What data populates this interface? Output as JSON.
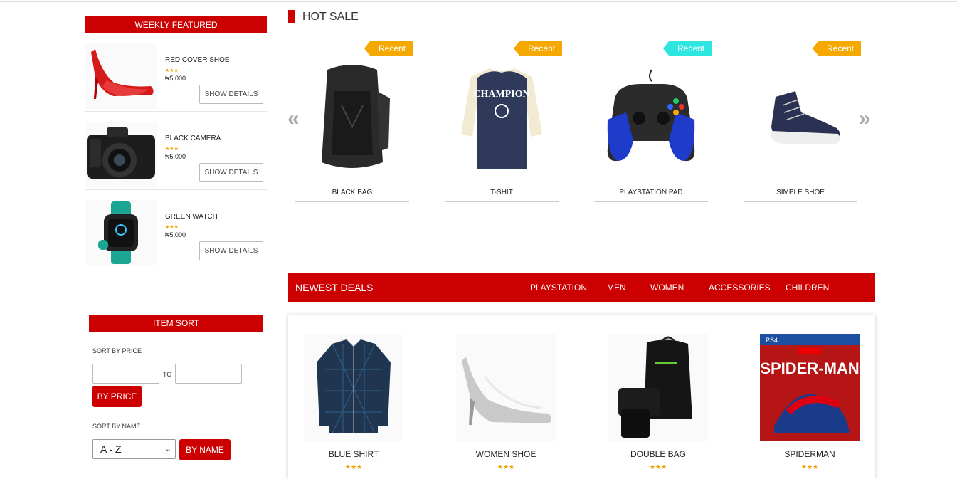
{
  "weekly_featured": {
    "title": "WEEKLY FEATURED",
    "items": [
      {
        "name": "RED COVER SHOE",
        "stars": "★★★",
        "price": "₦5,000",
        "button": "SHOW DETAILS",
        "icon": "red-heel-icon"
      },
      {
        "name": "BLACK CAMERA",
        "stars": "★★★",
        "price": "₦5,000",
        "button": "SHOW DETAILS",
        "icon": "camera-icon"
      },
      {
        "name": "GREEN WATCH",
        "stars": "★★★",
        "price": "₦5,000",
        "button": "SHOW DETAILS",
        "icon": "smartwatch-icon"
      }
    ]
  },
  "item_sort": {
    "title": "ITEM SORT",
    "price_label": "SORT BY PRICE",
    "to_label": "TO",
    "price_button": "BY PRICE",
    "name_label": "SORT BY NAME",
    "name_select": "A - Z",
    "name_button": "BY NAME"
  },
  "hot_sale": {
    "title": "HOT SALE",
    "prev_arrow": "«",
    "next_arrow": "»",
    "items": [
      {
        "tag": "Recent",
        "tag_color": "#f5a800",
        "name": "BLACK BAG",
        "icon": "backpack-icon"
      },
      {
        "tag": "Recent",
        "tag_color": "#f5a800",
        "name": "T-SHIT",
        "icon": "tshirt-icon"
      },
      {
        "tag": "Recent",
        "tag_color": "#2ee6e0",
        "name": "PLAYSTATION PAD",
        "icon": "gamepad-icon"
      },
      {
        "tag": "Recent",
        "tag_color": "#f5a800",
        "name": "SIMPLE SHOE",
        "icon": "sneaker-icon"
      }
    ]
  },
  "newest_deals": {
    "title": "NEWEST DEALS",
    "categories": [
      "PLAYSTATION",
      "MEN",
      "WOMEN",
      "ACCESSORIES",
      "CHILDREN"
    ],
    "items": [
      {
        "name": "BLUE SHIRT",
        "stars": "★★★",
        "icon": "shirt-icon"
      },
      {
        "name": "WOMEN SHOE",
        "stars": "★★★",
        "icon": "silver-heel-icon"
      },
      {
        "name": "DOUBLE BAG",
        "stars": "★★★",
        "icon": "bag-set-icon"
      },
      {
        "name": "SPIDERMAN",
        "stars": "★★★",
        "icon": "game-cover-icon"
      }
    ]
  },
  "colors": {
    "accent": "#cc0000",
    "star": "#f0a000"
  }
}
